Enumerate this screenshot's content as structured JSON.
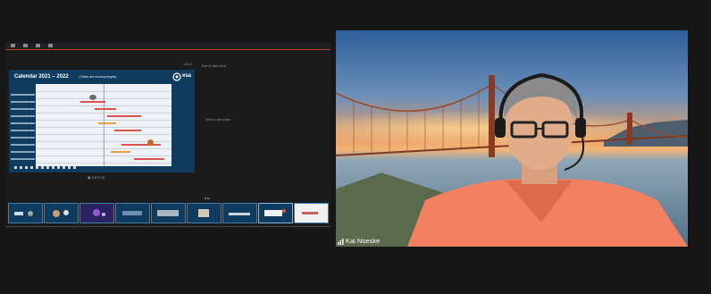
{
  "presenter": {
    "time": "13:13",
    "end_show": "End of slide show",
    "click_notes": "Click to add notes",
    "slide_nav": "◉  13/73  ◎"
  },
  "slide": {
    "title": "Calendar 2021 – 2022",
    "subtitle": "( Dates are moving targets)",
    "logo_text": "esa"
  },
  "thumbnails": {
    "count": 9,
    "active_index": 6
  },
  "video": {
    "participant_name": "Kai Noeske"
  },
  "colors": {
    "app_bg": "#161616",
    "ribbon_accent": "#c0452e",
    "slide_blue": "#0f3b5e",
    "thumb_border": "#3d7fb0"
  },
  "icons": [
    "signal-bars-icon",
    "esa-logo-icon"
  ]
}
